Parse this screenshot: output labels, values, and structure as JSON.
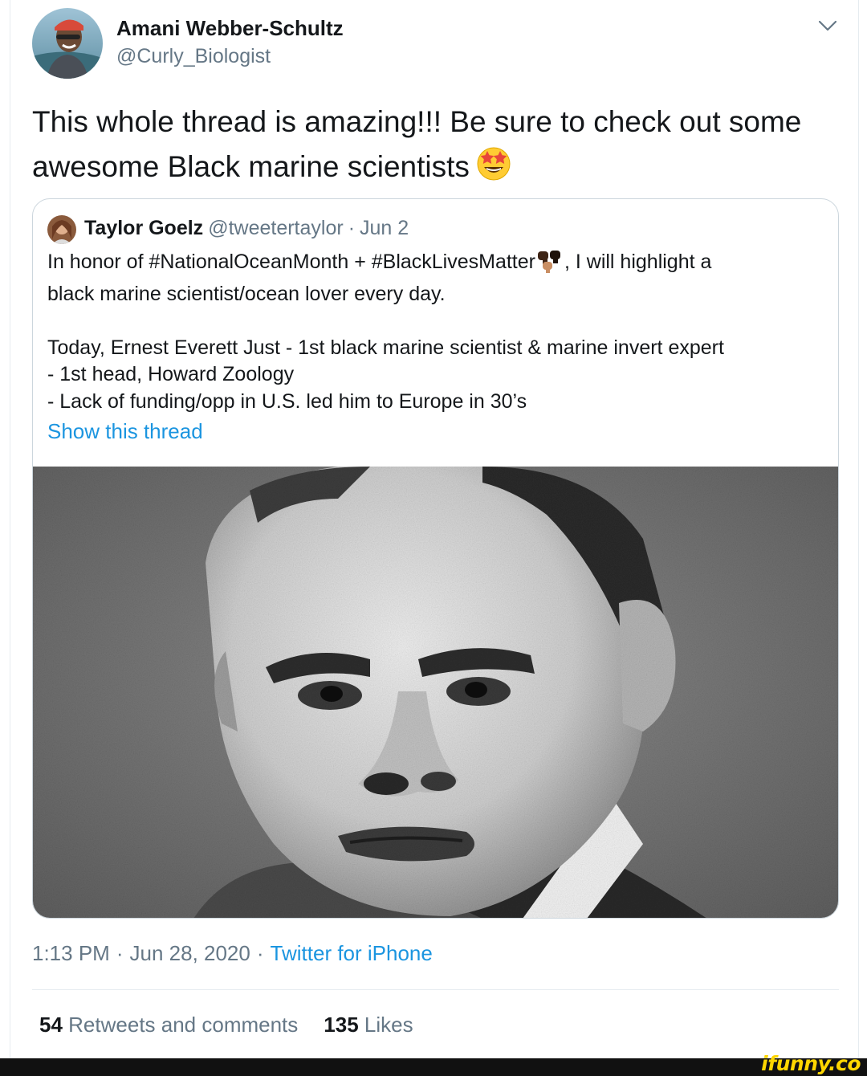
{
  "tweet": {
    "author_name": "Amani Webber-Schultz",
    "author_handle": "@Curly_Biologist",
    "text": "This whole thread is amazing!!! Be sure to check out some awesome Black marine scientists",
    "emoji": "star-struck-emoji",
    "time": "1:13 PM",
    "date": "Jun 28, 2020",
    "separator": "·",
    "source": "Twitter for iPhone",
    "retweets_count": "54",
    "retweets_label": "Retweets and comments",
    "likes_count": "135",
    "likes_label": "Likes"
  },
  "quoted_tweet": {
    "name": "Taylor Goelz",
    "handle": "@tweetertaylor",
    "separator": "·",
    "date": "Jun 2",
    "line1_before_emoji": "In honor of #NationalOceanMonth + #BlackLivesMatter",
    "line1_after_emoji": ", I will highlight a",
    "line2": "black marine scientist/ocean lover every day.",
    "line3": "Today, Ernest Everett Just - 1st black marine scientist & marine invert expert",
    "line4": "- 1st head, Howard Zoology",
    "line5": "- Lack of funding/opp in U.S. led him to Europe in 30’s",
    "show_thread": "Show this thread",
    "emoji": "raised-fists-emoji",
    "photo": "portrait-photo"
  },
  "watermark": {
    "text": "ifunny.co"
  },
  "colors": {
    "link": "#1b95e0",
    "secondary_text": "#657786",
    "primary_text": "#14171a",
    "border": "#ccd6dd"
  }
}
